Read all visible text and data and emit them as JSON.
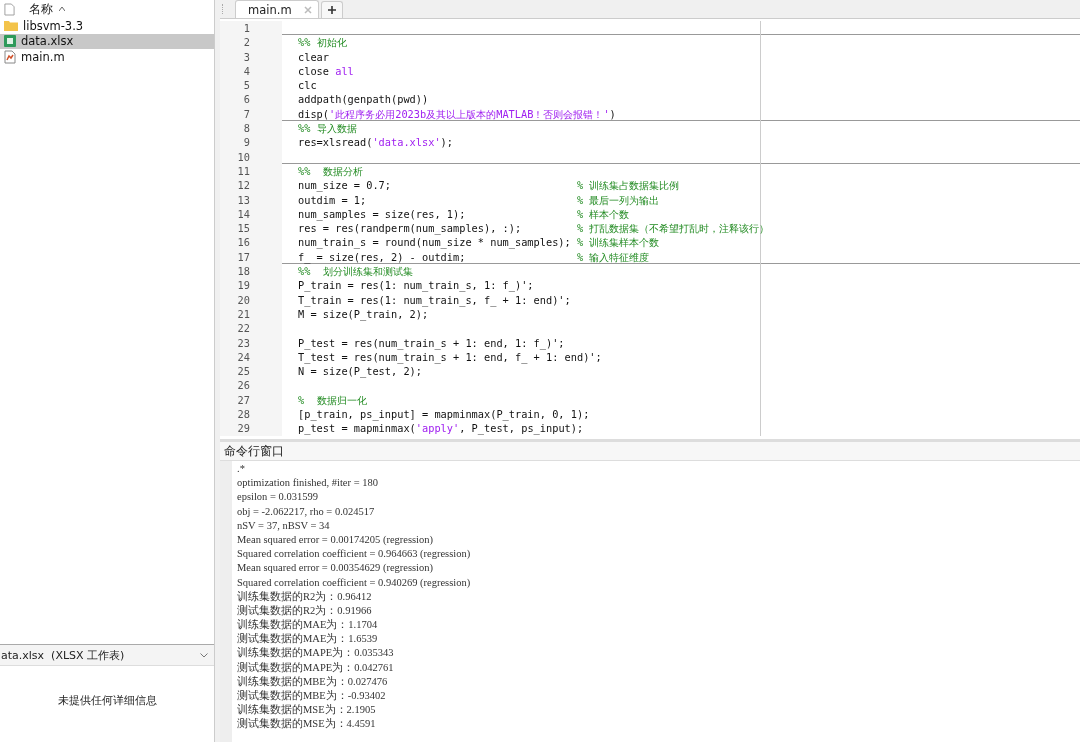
{
  "file_browser": {
    "column_header": "名称",
    "items": [
      {
        "name": "libsvm-3.3",
        "kind": "folder",
        "selected": false
      },
      {
        "name": "data.xlsx",
        "kind": "spreadsheet",
        "selected": true
      },
      {
        "name": "main.m",
        "kind": "script",
        "selected": false
      }
    ],
    "details": {
      "title": "ata.xlsx  (XLSX 工作表)",
      "message": "未提供任何详细信息"
    }
  },
  "editor": {
    "tabs": [
      {
        "label": "main.m",
        "selected": true
      }
    ],
    "lines": [
      {
        "n": "1",
        "section_start": false
      },
      {
        "n": "2",
        "section_start": true,
        "parts": [
          {
            "kind": "comment",
            "text": "%% 初始化"
          }
        ]
      },
      {
        "n": "3",
        "section_start": false,
        "parts": [
          {
            "kind": "code",
            "text": "clear"
          }
        ]
      },
      {
        "n": "4",
        "section_start": false,
        "parts": [
          {
            "kind": "code",
            "text": "close "
          },
          {
            "kind": "string",
            "text": "all"
          }
        ]
      },
      {
        "n": "5",
        "section_start": false,
        "parts": [
          {
            "kind": "code",
            "text": "clc"
          }
        ]
      },
      {
        "n": "6",
        "section_start": false,
        "parts": [
          {
            "kind": "code",
            "text": "addpath(genpath(pwd))"
          }
        ]
      },
      {
        "n": "7",
        "section_start": false,
        "parts": [
          {
            "kind": "code",
            "text": "disp("
          },
          {
            "kind": "string",
            "text": "'此程序务必用2023b及其以上版本的MATLAB！否则会报错！'"
          },
          {
            "kind": "code",
            "text": ")"
          }
        ]
      },
      {
        "n": "8",
        "section_start": true,
        "parts": [
          {
            "kind": "comment",
            "text": "%% 导入数据"
          }
        ]
      },
      {
        "n": "9",
        "section_start": false,
        "parts": [
          {
            "kind": "code",
            "text": "res=xlsread("
          },
          {
            "kind": "string",
            "text": "'data.xlsx'"
          },
          {
            "kind": "code",
            "text": ");"
          }
        ]
      },
      {
        "n": "10",
        "section_start": false
      },
      {
        "n": "11",
        "section_start": true,
        "parts": [
          {
            "kind": "comment",
            "text": "%%  数据分析"
          }
        ]
      },
      {
        "n": "12",
        "section_start": false,
        "parts": [
          {
            "kind": "code",
            "text": "num_size = 0.7;"
          }
        ],
        "comment": "% 训练集占数据集比例"
      },
      {
        "n": "13",
        "section_start": false,
        "parts": [
          {
            "kind": "code",
            "text": "outdim = 1;"
          }
        ],
        "comment": "% 最后一列为输出"
      },
      {
        "n": "14",
        "section_start": false,
        "parts": [
          {
            "kind": "code",
            "text": "num_samples = size(res, 1);"
          }
        ],
        "comment": "% 样本个数"
      },
      {
        "n": "15",
        "section_start": false,
        "parts": [
          {
            "kind": "code",
            "text": "res = res(randperm(num_samples), :);"
          }
        ],
        "comment": "% 打乱数据集（不希望打乱时，注释该行）"
      },
      {
        "n": "16",
        "section_start": false,
        "parts": [
          {
            "kind": "code",
            "text": "num_train_s = round(num_size * num_samples);"
          }
        ],
        "comment": "% 训练集样本个数"
      },
      {
        "n": "17",
        "section_start": false,
        "parts": [
          {
            "kind": "code",
            "text": "f_ = size(res, 2) - outdim;"
          }
        ],
        "comment": "% 输入特征维度"
      },
      {
        "n": "18",
        "section_start": true,
        "parts": [
          {
            "kind": "comment",
            "text": "%%  划分训练集和测试集"
          }
        ]
      },
      {
        "n": "19",
        "section_start": false,
        "parts": [
          {
            "kind": "code",
            "text": "P_train = res(1: num_train_s, 1: f_)';"
          }
        ]
      },
      {
        "n": "20",
        "section_start": false,
        "parts": [
          {
            "kind": "code",
            "text": "T_train = res(1: num_train_s, f_ + 1: end)';"
          }
        ]
      },
      {
        "n": "21",
        "section_start": false,
        "parts": [
          {
            "kind": "code",
            "text": "M = size(P_train, 2);"
          }
        ]
      },
      {
        "n": "22",
        "section_start": false
      },
      {
        "n": "23",
        "section_start": false,
        "parts": [
          {
            "kind": "code",
            "text": "P_test = res(num_train_s + 1: end, 1: f_)';"
          }
        ]
      },
      {
        "n": "24",
        "section_start": false,
        "parts": [
          {
            "kind": "code",
            "text": "T_test = res(num_train_s + 1: end, f_ + 1: end)';"
          }
        ]
      },
      {
        "n": "25",
        "section_start": false,
        "parts": [
          {
            "kind": "code",
            "text": "N = size(P_test, 2);"
          }
        ]
      },
      {
        "n": "26",
        "section_start": false
      },
      {
        "n": "27",
        "section_start": false,
        "parts": [
          {
            "kind": "comment",
            "text": "%  数据归一化"
          }
        ]
      },
      {
        "n": "28",
        "section_start": false,
        "parts": [
          {
            "kind": "code",
            "text": "[p_train, ps_input] = mapminmax(P_train, 0, 1);"
          }
        ]
      },
      {
        "n": "29",
        "section_start": false,
        "parts": [
          {
            "kind": "code",
            "text": "p_test = mapminmax("
          },
          {
            "kind": "string",
            "text": "'apply'"
          },
          {
            "kind": "code",
            "text": ", P_test, ps_input);"
          }
        ]
      }
    ]
  },
  "command_window": {
    "title": "命令行窗口",
    "lines": [
      ".*",
      "optimization finished, #iter = 180",
      "epsilon = 0.031599",
      "obj = -2.062217, rho = 0.024517",
      "nSV = 37, nBSV = 34",
      "Mean squared error = 0.00174205 (regression)",
      "Squared correlation coefficient = 0.964663 (regression)",
      "Mean squared error = 0.00354629 (regression)",
      "Squared correlation coefficient = 0.940269 (regression)",
      "训练集数据的R2为：0.96412",
      "测试集数据的R2为：0.91966",
      "训练集数据的MAE为：1.1704",
      "测试集数据的MAE为：1.6539",
      "训练集数据的MAPE为：0.035343",
      "测试集数据的MAPE为：0.042761",
      "训练集数据的MBE为：0.027476",
      "测试集数据的MBE为：-0.93402",
      "训练集数据的MSE为：2.1905",
      "测试集数据的MSE为：4.4591"
    ]
  }
}
